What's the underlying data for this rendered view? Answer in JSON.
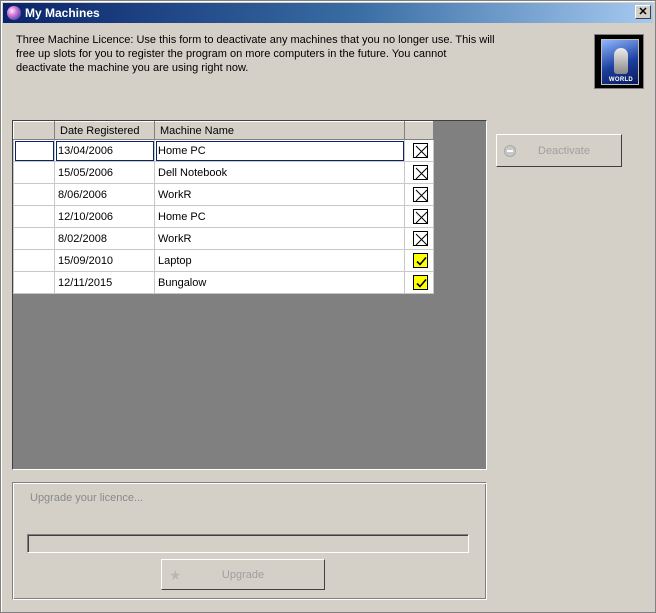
{
  "window": {
    "title": "My Machines",
    "close_glyph": "✕"
  },
  "description": "Three Machine Licence: Use this form to deactivate any machines that you no longer use. This will free up slots for you to register the program on more computers in the future. You cannot deactivate the machine you are using right now.",
  "logo": {
    "label": "WORLD",
    "icon": "world-logo-icon"
  },
  "table": {
    "columns": [
      "",
      "Date Registered",
      "Machine Name",
      ""
    ],
    "rows": [
      {
        "date": "13/04/2006",
        "name": "Home PC",
        "state": "x",
        "selected": true
      },
      {
        "date": "15/05/2006",
        "name": "Dell Notebook",
        "state": "x",
        "selected": false
      },
      {
        "date": "8/06/2006",
        "name": "WorkR",
        "state": "x",
        "selected": false
      },
      {
        "date": "12/10/2006",
        "name": "Home PC",
        "state": "x",
        "selected": false
      },
      {
        "date": "8/02/2008",
        "name": "WorkR",
        "state": "x",
        "selected": false
      },
      {
        "date": "15/09/2010",
        "name": "Laptop",
        "state": "check",
        "selected": false
      },
      {
        "date": "12/11/2015",
        "name": "Bungalow",
        "state": "check",
        "selected": false
      }
    ]
  },
  "actions": {
    "deactivate_label": "Deactivate",
    "deactivate_enabled": false,
    "deactivate_icon": "minus-circle-icon"
  },
  "upgrade": {
    "text": "Upgrade your licence...",
    "progress": 0,
    "button_label": "Upgrade",
    "button_enabled": false,
    "button_icon": "star-icon"
  },
  "colors": {
    "title_bar": "#0a246a",
    "active_check": "#ffff00",
    "disabled_text": "#a0a0a0"
  }
}
